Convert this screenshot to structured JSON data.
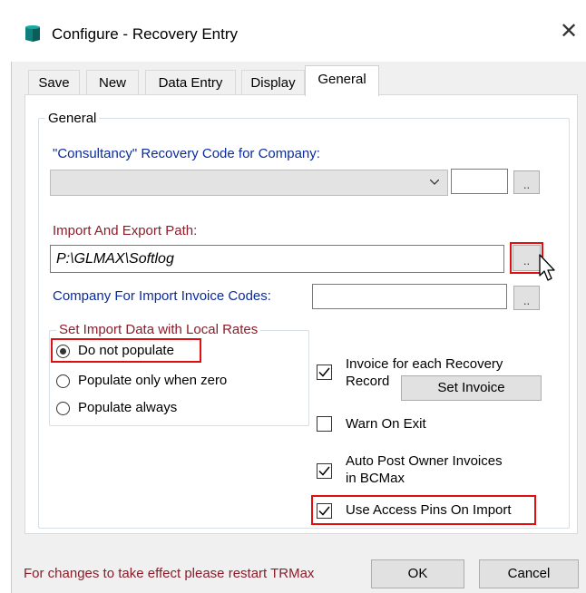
{
  "window": {
    "title": "Configure - Recovery Entry",
    "app_icon": "database-icon",
    "close_icon": "close-icon",
    "close_glyph": "✕"
  },
  "tabs": [
    {
      "label": "Save"
    },
    {
      "label": "New"
    },
    {
      "label": "Data Entry"
    },
    {
      "label": "Display"
    },
    {
      "label": "General",
      "active": true
    }
  ],
  "general": {
    "group_title": "General",
    "consultancy_label": "\"Consultancy\" Recovery Code for Company:",
    "consultancy_combo_value": "",
    "consultancy_text_value": "",
    "browse_label": "..",
    "import_export_label": "Import And Export Path:",
    "import_export_path": "P:\\GLMAX\\Softlog",
    "company_import_label": "Company For Import Invoice Codes:",
    "company_import_value": ""
  },
  "local_rates": {
    "group_title": "Set Import Data with Local Rates",
    "options": [
      {
        "label": "Do not populate",
        "selected": true
      },
      {
        "label": "Populate only when zero",
        "selected": false
      },
      {
        "label": "Populate always",
        "selected": false
      }
    ]
  },
  "options": {
    "invoice_each_line1": "Invoice for each Recovery",
    "invoice_each_line2": "Record",
    "invoice_each_checked": true,
    "set_invoice_label": "Set Invoice",
    "warn_on_exit_label": "Warn On Exit",
    "warn_on_exit_checked": false,
    "auto_post_line1": "Auto Post Owner Invoices",
    "auto_post_line2": "in BCMax",
    "auto_post_checked": true,
    "access_pins_label": "Use Access Pins On Import",
    "access_pins_checked": true
  },
  "footer": {
    "restart_note": "For changes to take effect please restart TRMax",
    "ok_label": "OK",
    "cancel_label": "Cancel"
  },
  "colors": {
    "highlight": "#e01010",
    "label_blue": "#0b2b9c",
    "label_red": "#8b1e2b"
  }
}
